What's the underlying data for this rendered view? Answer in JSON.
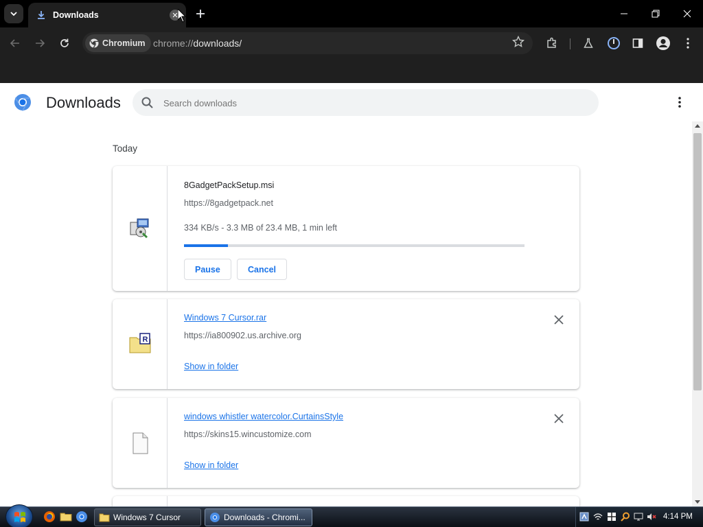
{
  "browser": {
    "tab_title": "Downloads",
    "chip_label": "Chromium",
    "url_scheme": "chrome://",
    "url_path": "downloads/"
  },
  "page": {
    "title": "Downloads",
    "search_placeholder": "Search downloads",
    "section_date": "Today"
  },
  "downloads": [
    {
      "filename": "8GadgetPackSetup.msi",
      "source": "https://8gadgetpack.net",
      "status": "334 KB/s - 3.3 MB of 23.4 MB, 1 min left",
      "progress": 0.13,
      "pause_label": "Pause",
      "cancel_label": "Cancel",
      "icon": "installer-file-icon"
    },
    {
      "filename": "Windows 7 Cursor.rar",
      "source": "https://ia800902.us.archive.org",
      "action_label": "Show in folder",
      "icon": "rar-archive-icon"
    },
    {
      "filename": "windows whistler watercolor.CurtainsStyle",
      "source": "https://skins15.wincustomize.com",
      "action_label": "Show in folder",
      "icon": "generic-file-icon"
    }
  ],
  "taskbar": {
    "tasks": [
      {
        "label": "Windows 7 Cursor"
      },
      {
        "label": "Downloads - Chromi..."
      }
    ],
    "clock": "4:14 PM"
  },
  "colors": {
    "accent": "#1a73e8",
    "chrome_dark": "#1f1f1f"
  }
}
